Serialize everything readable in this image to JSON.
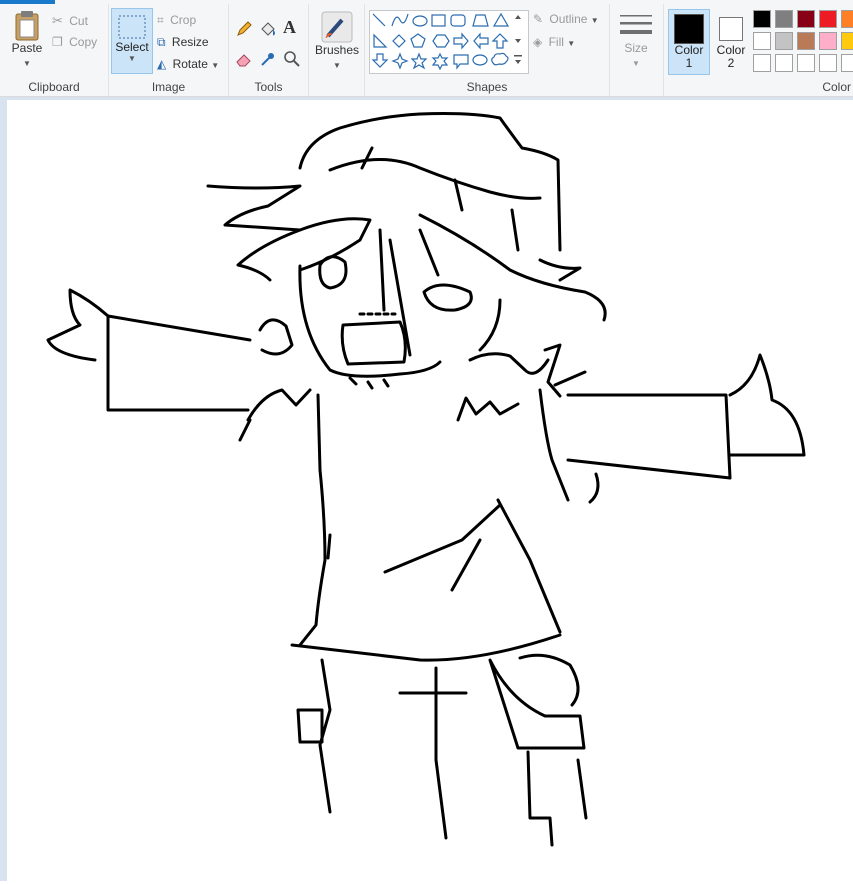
{
  "clipboard": {
    "paste_label": "Paste",
    "cut_label": "Cut",
    "copy_label": "Copy",
    "group_label": "Clipboard"
  },
  "image": {
    "select_label": "Select",
    "crop_label": "Crop",
    "resize_label": "Resize",
    "rotate_label": "Rotate",
    "group_label": "Image"
  },
  "tools": {
    "group_label": "Tools",
    "text_tool_glyph": "A"
  },
  "brushes": {
    "label": "Brushes"
  },
  "shapes": {
    "outline_label": "Outline",
    "fill_label": "Fill",
    "group_label": "Shapes",
    "icons": [
      "line-shape-icon",
      "curve-shape-icon",
      "oval-shape-icon",
      "rectangle-shape-icon",
      "rounded-rectangle-shape-icon",
      "polygon-shape-icon",
      "triangle-shape-icon",
      "right-triangle-shape-icon",
      "diamond-shape-icon",
      "pentagon-shape-icon",
      "hexagon-shape-icon",
      "right-arrow-shape-icon",
      "left-arrow-shape-icon",
      "up-arrow-shape-icon",
      "down-arrow-shape-icon",
      "four-point-star-shape-icon",
      "five-point-star-shape-icon",
      "six-point-star-shape-icon",
      "rect-callout-shape-icon",
      "oval-callout-shape-icon",
      "cloud-callout-shape-icon"
    ]
  },
  "size": {
    "label": "Size"
  },
  "colors": {
    "color1_label": "Color",
    "color1_num": "1",
    "color2_label": "Color",
    "color2_num": "2",
    "group_label": "Color",
    "color1_value": "#000000",
    "color2_value": "#ffffff",
    "palette_row1": [
      "#000000",
      "#7f7f7f",
      "#880015",
      "#ed1c24",
      "#ff7f27"
    ],
    "palette_row2": [
      "#ffffff",
      "#c3c3c3",
      "#b97a57",
      "#ffaec9",
      "#ffc90e"
    ],
    "palette_row3": [
      "#ffffff",
      "#ffffff",
      "#ffffff",
      "#ffffff",
      "#ffffff"
    ]
  },
  "theme": {
    "accent": "#1979ca",
    "ribbon_bg": "#f5f6f7",
    "selected_bg": "#cce4f7",
    "canvas_bg": "#ffffff",
    "workspace_bg": "#d9e3ef"
  }
}
